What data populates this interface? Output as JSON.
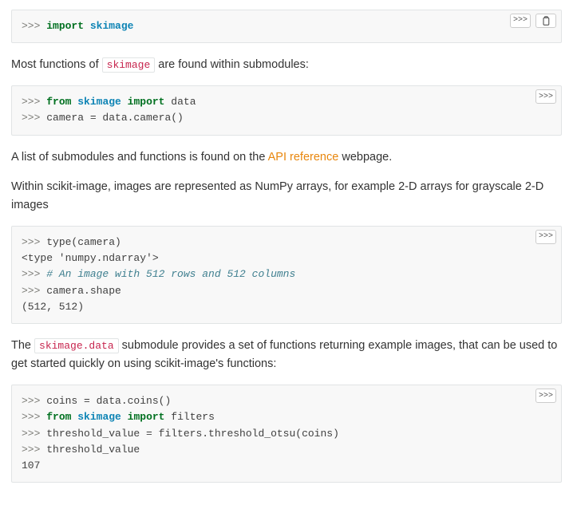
{
  "toolbar": {
    "prompt_toggle_label": ">>>"
  },
  "block1": {
    "l1": {
      "prompt": ">>> ",
      "kw": "import",
      "sp": " ",
      "nm": "skimage"
    }
  },
  "para1": {
    "a": "Most functions of ",
    "code": "skimage",
    "b": " are found within submodules:"
  },
  "block2": {
    "l1": {
      "prompt": ">>> ",
      "kw": "from",
      "sp1": " ",
      "nm": "skimage",
      "sp2": " ",
      "kw2": "import",
      "rest": " data"
    },
    "l2": {
      "prompt": ">>> ",
      "txt": "camera = data.camera()"
    }
  },
  "para2": {
    "a": "A list of submodules and functions is found on the ",
    "link": "API reference",
    "b": " webpage."
  },
  "para3": {
    "a": "Within scikit-image, images are represented as NumPy arrays, for example 2-D arrays for grayscale 2-D images"
  },
  "block3": {
    "l1": {
      "prompt": ">>> ",
      "txt": "type(camera)"
    },
    "l2": {
      "txt": "<type 'numpy.ndarray'>"
    },
    "l3": {
      "prompt": ">>> ",
      "cm": "# An image with 512 rows and 512 columns"
    },
    "l4": {
      "prompt": ">>> ",
      "txt": "camera.shape"
    },
    "l5": {
      "txt": "(512, 512)"
    }
  },
  "para4": {
    "a": "The ",
    "code": "skimage.data",
    "b": " submodule provides a set of functions returning example images, that can be used to get started quickly on using scikit-image's functions:"
  },
  "block4": {
    "l1": {
      "prompt": ">>> ",
      "txt": "coins = data.coins()"
    },
    "l2": {
      "prompt": ">>> ",
      "kw": "from",
      "sp1": " ",
      "nm": "skimage",
      "sp2": " ",
      "kw2": "import",
      "rest": " filters"
    },
    "l3": {
      "prompt": ">>> ",
      "txt": "threshold_value = filters.threshold_otsu(coins)"
    },
    "l4": {
      "prompt": ">>> ",
      "txt": "threshold_value"
    },
    "l5": {
      "txt": "107"
    }
  }
}
